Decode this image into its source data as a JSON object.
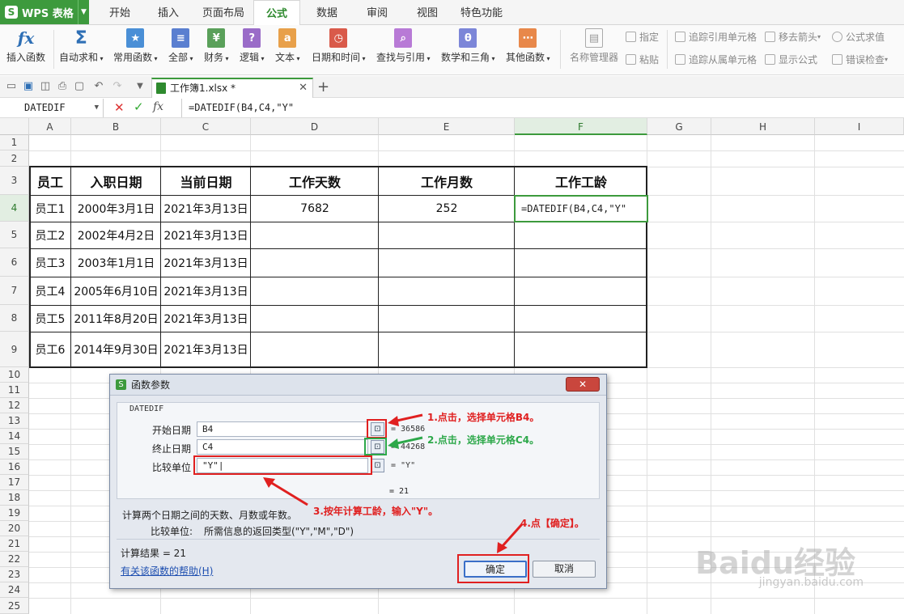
{
  "app": {
    "name": "WPS 表格"
  },
  "menu_tabs": [
    "开始",
    "插入",
    "页面布局",
    "公式",
    "数据",
    "审阅",
    "视图",
    "特色功能"
  ],
  "active_tab": "公式",
  "ribbon": {
    "insert_func": "插入函数",
    "autosum": "自动求和",
    "common": "常用函数",
    "all": "全部",
    "finance": "财务",
    "logic": "逻辑",
    "text": "文本",
    "datetime": "日期和时间",
    "lookup": "查找与引用",
    "math": "数学和三角",
    "other": "其他函数",
    "name_mgr": "名称管理器",
    "assign": "指定",
    "paste": "粘贴",
    "trace_prec": "追踪引用单元格",
    "trace_dep": "追踪从属单元格",
    "remove_arrows": "移去箭头",
    "show_formula": "显示公式",
    "eval_formula": "公式求值",
    "error_check": "错误检查"
  },
  "doc_tab": "工作簿1.xlsx *",
  "formula_bar": {
    "name_box": "DATEDIF",
    "formula": "=DATEDIF(B4,C4,\"Y\""
  },
  "columns": [
    "A",
    "B",
    "C",
    "D",
    "E",
    "F",
    "G",
    "H",
    "I"
  ],
  "rows": [
    "1",
    "2",
    "3",
    "4",
    "5",
    "6",
    "7",
    "8",
    "9",
    "10",
    "11",
    "12",
    "13",
    "14",
    "15",
    "16",
    "17",
    "18",
    "19",
    "20",
    "21",
    "22",
    "23",
    "24",
    "25"
  ],
  "table": {
    "headers": [
      "员工",
      "入职日期",
      "当前日期",
      "工作天数",
      "工作月数",
      "工作工龄"
    ],
    "rows": [
      [
        "员工1",
        "2000年3月1日",
        "2021年3月13日",
        "7682",
        "252",
        "=DATEDIF(B4,C4,\"Y\""
      ],
      [
        "员工2",
        "2002年4月2日",
        "2021年3月13日",
        "",
        "",
        ""
      ],
      [
        "员工3",
        "2003年1月1日",
        "2021年3月13日",
        "",
        "",
        ""
      ],
      [
        "员工4",
        "2005年6月10日",
        "2021年3月13日",
        "",
        "",
        ""
      ],
      [
        "员工5",
        "2011年8月20日",
        "2021年3月13日",
        "",
        "",
        ""
      ],
      [
        "员工6",
        "2014年9月30日",
        "2021年3月13日",
        "",
        "",
        ""
      ]
    ]
  },
  "dialog": {
    "title": "函数参数",
    "close": "✕",
    "func_name": "DATEDIF",
    "params": [
      {
        "label": "开始日期",
        "value": "B4",
        "result": "= 36586"
      },
      {
        "label": "终止日期",
        "value": "C4",
        "result": "= 44268"
      },
      {
        "label": "比较单位",
        "value": "\"Y\"|",
        "result": "= \"Y\""
      }
    ],
    "formula_result": "= 21",
    "description": "计算两个日期之间的天数、月数或年数。",
    "param_desc_label": "比较单位:",
    "param_desc": "所需信息的返回类型(\"Y\",\"M\",\"D\")",
    "calc_result": "计算结果 = 21",
    "help_link": "有关该函数的帮助(H)",
    "ok": "确定",
    "cancel": "取消"
  },
  "annotations": [
    "1.点击，选择单元格B4。",
    "2.点击，选择单元格C4。",
    "3.按年计算工龄，输入\"Y\"。",
    "4.点【确定】。"
  ],
  "watermark": {
    "brand": "Baidu经验",
    "url": "jingyan.baidu.com"
  },
  "colors": {
    "wps_green": "#3d9a3d",
    "annotation_red": "#e02020",
    "annotation_green": "#2da84a"
  }
}
